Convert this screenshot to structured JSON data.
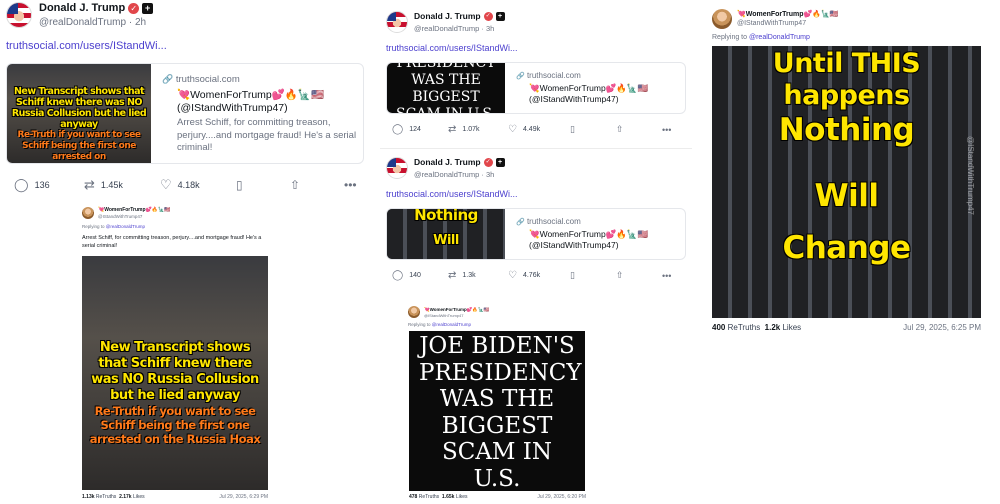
{
  "post1": {
    "author": "Donald J. Trump",
    "handle": "@realDonaldTrump",
    "time": "2h",
    "link": "truthsocial.com/users/IStandWi...",
    "card": {
      "domain": "truthsocial.com",
      "title": "💘WomenForTrump💕🔥🗽🇺🇸 (@IStandWithTrump47)",
      "desc": "Arrest Schiff, for committing treason, perjury....and mortgage fraud! He's a serial criminal!",
      "thumb_line1": "New Transcript shows that Schiff knew there was NO Russia Collusion but he lied anyway",
      "thumb_line2": "Re-Truth if you want to see Schiff being the first one arrested on"
    },
    "replies": "136",
    "retruths": "1.45k",
    "likes": "4.18k"
  },
  "embed1": {
    "name": "💘WomenForTrump💕🔥🗽🇺🇸",
    "handle": "@IStandWithTrump47",
    "reply_prefix": "Replying to",
    "reply_to": "@realDonaldTrump",
    "text": "Arrest Schiff, for committing treason, perjury....and mortgage fraud! He's a serial criminal!",
    "meme_top": "New Transcript shows that Schiff knew there was NO Russia Collusion but he lied anyway",
    "meme_bottom": "Re-Truth if you want to see Schiff being the first one arrested on the Russia Hoax",
    "retruths": "1.13k",
    "retruths_label": "ReTruths",
    "likes": "2.17k",
    "likes_label": "Likes",
    "date": "Jul 29, 2025, 6:29 PM"
  },
  "post2": {
    "author": "Donald J. Trump",
    "handle": "@realDonaldTrump",
    "time": "3h",
    "link": "truthsocial.com/users/IStandWi...",
    "card": {
      "domain": "truthsocial.com",
      "title": "💘WomenForTrump💕🔥🗽🇺🇸 (@IStandWithTrump47)",
      "thumb_text": "PRESIDENCY WAS THE BIGGEST SCAM IN U.S."
    },
    "replies": "124",
    "retruths": "1.07k",
    "likes": "4.49k"
  },
  "post3": {
    "author": "Donald J. Trump",
    "handle": "@realDonaldTrump",
    "time": "3h",
    "link": "truthsocial.com/users/IStandWi...",
    "card": {
      "domain": "truthsocial.com",
      "title": "💘WomenForTrump💕🔥🗽🇺🇸 (@IStandWithTrump47)",
      "thumb_text1": "Nothing",
      "thumb_text2": "Will"
    },
    "replies": "140",
    "retruths": "1.3k",
    "likes": "4.76k"
  },
  "embed2": {
    "name": "💘WomenForTrump💕🔥🗽🇺🇸",
    "handle": "@IStandWithTrump47",
    "reply_prefix": "Replying to",
    "reply_to": "@realDonaldTrump",
    "meme_text": "JOE BIDEN'S PRESIDENCY WAS THE BIGGEST SCAM IN U.S. HISTORY!",
    "retruths": "478",
    "retruths_label": "ReTruths",
    "likes": "1.65k",
    "likes_label": "Likes",
    "date": "Jul 29, 2025, 6:20 PM"
  },
  "embed3": {
    "name": "💘WomenForTrump💕🔥🗽🇺🇸",
    "handle": "@IStandWithTrump47",
    "reply_prefix": "Replying to",
    "reply_to": "@realDonaldTrump",
    "meme_line1": "Until THIS happens",
    "meme_line2": "Nothing",
    "meme_line3": "Will",
    "meme_line4": "Change",
    "watermark": "@IStandWithTrump47",
    "retruths": "400",
    "retruths_label": "ReTruths",
    "likes": "1.2k",
    "likes_label": "Likes",
    "date": "Jul 29, 2025, 6:25 PM"
  },
  "colors": {
    "link": "#4b3fce",
    "verified": "#e1464b",
    "meme_yellow": "#ffe600",
    "meme_orange": "#ff7a1a",
    "muted": "#6b7280"
  },
  "icons": [
    "reply-icon",
    "retruth-icon",
    "like-icon",
    "bookmark-icon",
    "share-icon",
    "more-icon",
    "verified-icon",
    "link-icon"
  ]
}
